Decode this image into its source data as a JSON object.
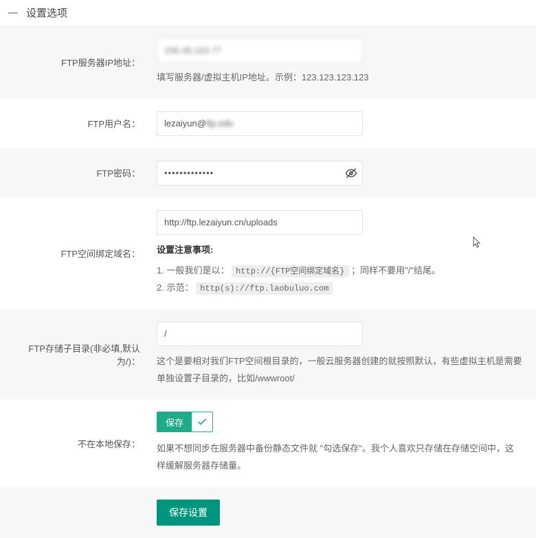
{
  "section_title": "设置选项",
  "rows": {
    "ip": {
      "label": "FTP服务器IP地址：",
      "value": "196.48.163.77",
      "hint": "填写服务器/虚拟主机IP地址。示例：123.123.123.123"
    },
    "user": {
      "label": "FTP用户名：",
      "value_prefix": "lezaiyun@",
      "value_blur": "ftp.edu"
    },
    "password": {
      "label": "FTP密码：",
      "value": "•••••••••••••"
    },
    "domain": {
      "label": "FTP空间绑定域名：",
      "value": "http://ftp.lezaiyun.cn/uploads",
      "hint_title": "设置注意事项:",
      "hint_line1_a": "1. 一般我们是以：",
      "hint_line1_code": "http://{FTP空间绑定域名}",
      "hint_line1_b": "；同样不要用\"/\"结尾。",
      "hint_line2_a": "2. 示范：",
      "hint_line2_code": "http(s)://ftp.laobuluo.com"
    },
    "subdir": {
      "label": "FTP存储子目录(非必填,默认为/)：",
      "value": "/",
      "hint": "这个是要相对我们FTP空间根目录的，一般云服务器创建的就按照默认，有些虚拟主机是需要单独设置子目录的，比如/wwwroot/"
    },
    "local_save": {
      "label": "不在本地保存：",
      "btn_label": "保存",
      "hint": "如果不想同步在服务器中备份静态文件就 \"勾选保存\"。我个人喜欢只存储在存储空间中，这样缓解服务器存储量。"
    },
    "submit": {
      "label": "保存设置"
    }
  }
}
